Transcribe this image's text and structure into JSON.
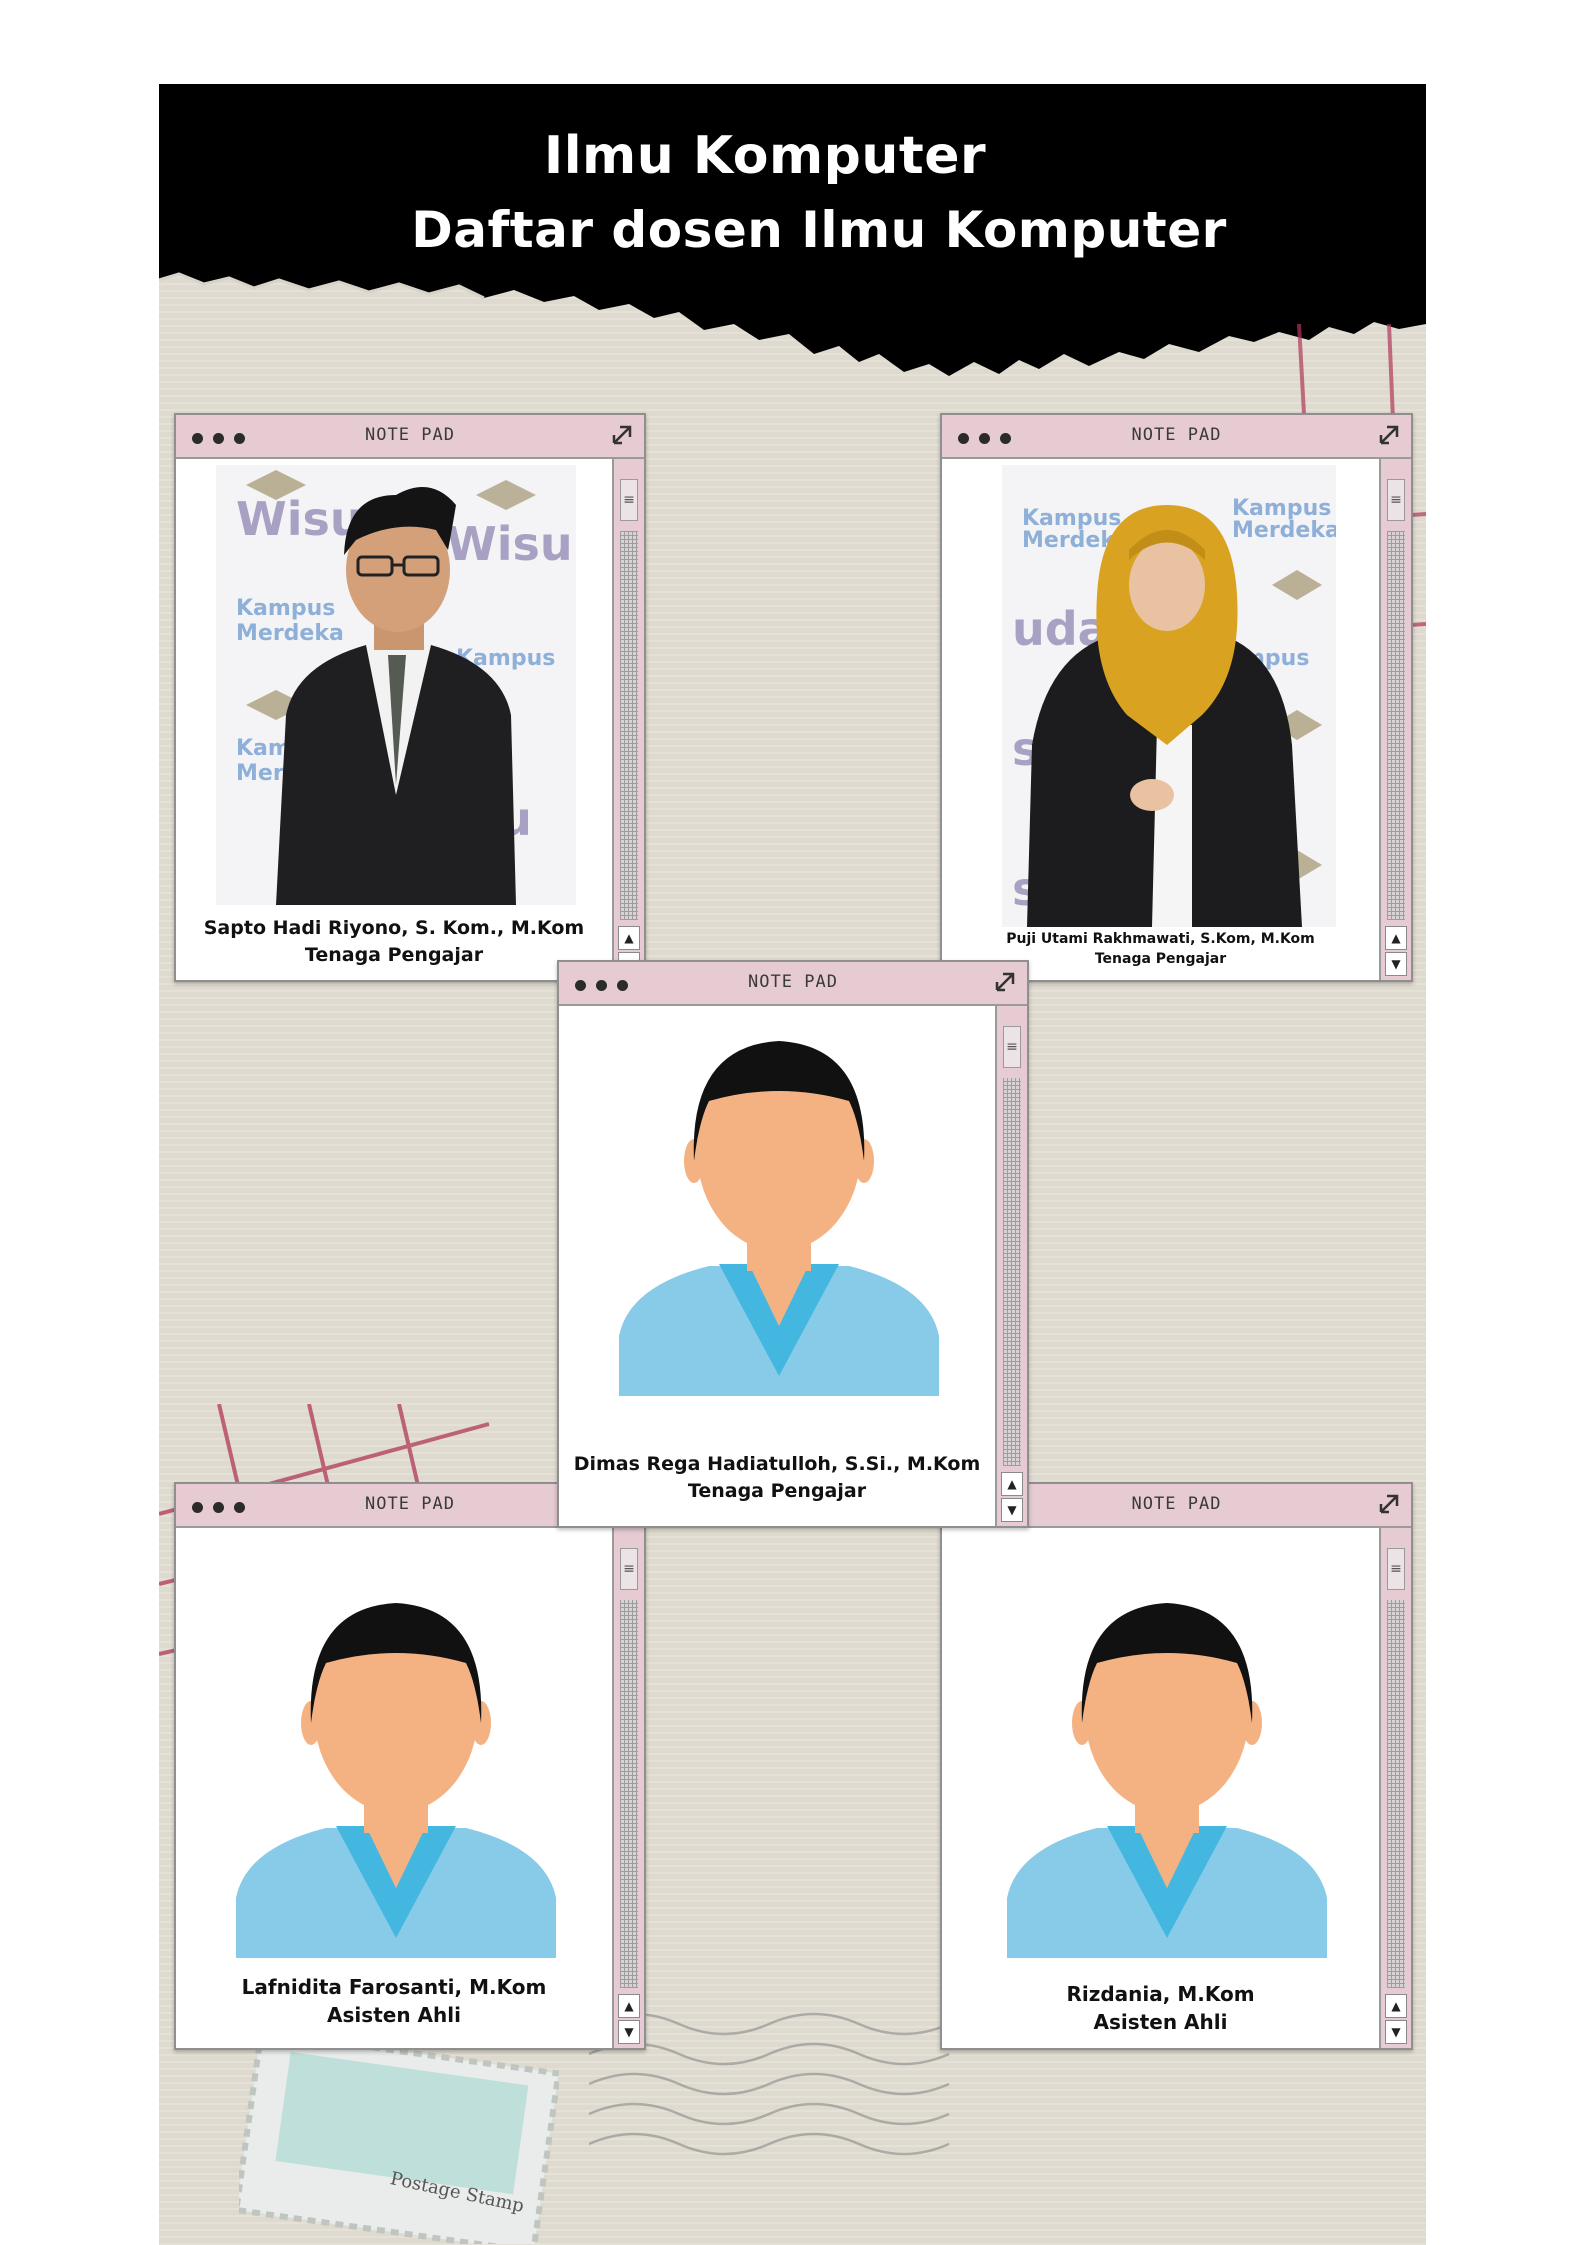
{
  "header": {
    "title_line1": "Ilmu Komputer",
    "title_line2": "Daftar dosen Ilmu Komputer"
  },
  "window_title": "NOTE PAD",
  "colors": {
    "header_black": "#000000",
    "paper": "#e3ded3",
    "window_pink": "#e6cbd3",
    "shirt_blue": "#87cbe8",
    "collar_blue": "#44b7e0",
    "skin": "#f4b282",
    "hair": "#111111",
    "hijab_mustard": "#d9a321"
  },
  "icons": {
    "window_dots": "three-dot-icon",
    "resize": "expand-arrow-icon",
    "scroll_grip": "grip-lines-icon",
    "scroll_up": "arrow-up-icon",
    "scroll_down": "arrow-down-icon"
  },
  "scroll_glyphs": {
    "grip": "≡",
    "up": "▲",
    "down": "▼"
  },
  "lecturers": [
    {
      "name": "Sapto Hadi Riyono, S. Kom., M.Kom",
      "role": "Tenaga Pengajar"
    },
    {
      "name": "Puji Utami Rakhmawati, S.Kom, M.Kom",
      "role": "Tenaga Pengajar"
    },
    {
      "name": "Dimas Rega Hadiatulloh, S.Si., M.Kom",
      "role": "Tenaga Pengajar"
    },
    {
      "name": "Lafnidita Farosanti, M.Kom",
      "role": "Asisten Ahli"
    },
    {
      "name": "Rizdania, M.Kom",
      "role": "Asisten Ahli"
    }
  ],
  "stamp_text": "Postage Stamp"
}
